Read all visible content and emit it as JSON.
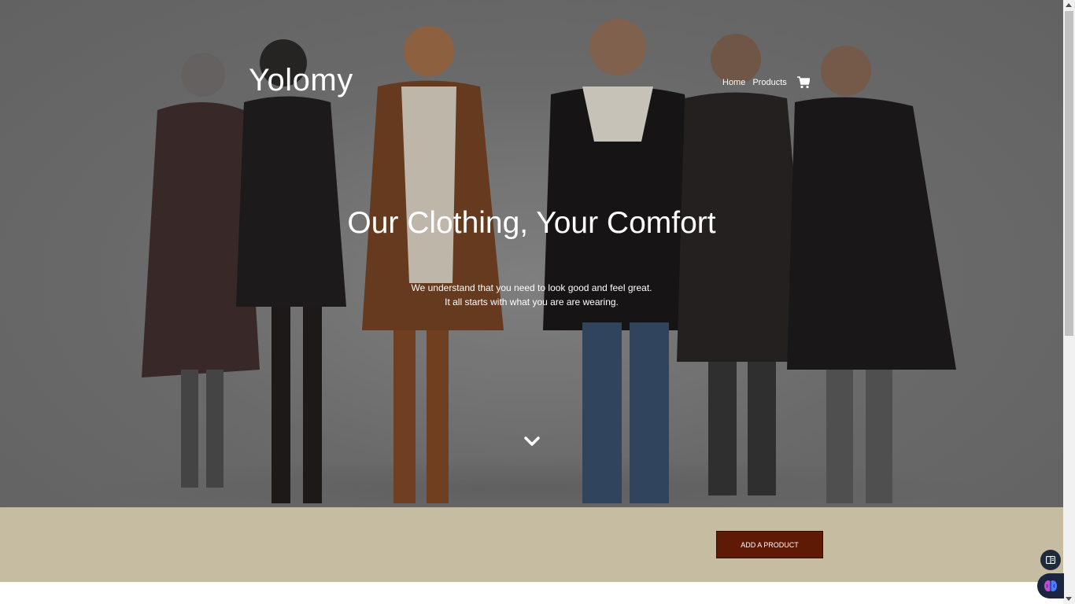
{
  "header": {
    "brand": "Yolomy",
    "nav": [
      {
        "label": "Home"
      },
      {
        "label": "Products"
      }
    ],
    "cart_icon": "shopping-cart-icon"
  },
  "hero": {
    "title": "Our Clothing, Your Comfort",
    "subtitle_line1": "We understand that you need to look good and feel great.",
    "subtitle_line2": "It all starts with what you are are wearing.",
    "scroll_icon": "chevron-down-icon",
    "image": "group of people in winter clothing"
  },
  "actions": {
    "add_product_label": "ADD A PRODUCT"
  },
  "colors": {
    "band": "#c6bca2",
    "button": "#5e1a05",
    "text": "#ffffff"
  },
  "widgets": {
    "reader_icon": "reader-mode-icon",
    "assistant_icon": "brain-assistant-icon"
  }
}
